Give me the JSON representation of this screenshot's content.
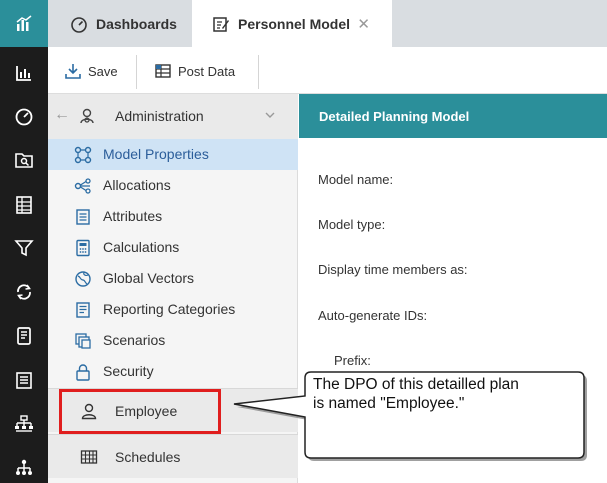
{
  "tabs": [
    {
      "label": "Dashboards",
      "icon": "dashboard-gauge-icon"
    },
    {
      "label": "Personnel Model",
      "icon": "edit-model-icon",
      "close": "✕"
    }
  ],
  "toolbar": {
    "save_label": "Save",
    "post_label": "Post Data"
  },
  "rail_icons": [
    "analytics-logo-icon",
    "bar-chart-icon",
    "gauge-icon",
    "search-folder-icon",
    "spreadsheet-icon",
    "filter-icon",
    "sync-icon",
    "calendar-book-icon",
    "report-icon",
    "hierarchy-icon",
    "org-chart-icon"
  ],
  "nav": {
    "header_label": "Administration",
    "back_glyph": "←",
    "items": [
      {
        "label": "Model Properties",
        "icon": "model-properties-icon",
        "selected": true
      },
      {
        "label": "Allocations",
        "icon": "allocations-icon"
      },
      {
        "label": "Attributes",
        "icon": "attributes-icon"
      },
      {
        "label": "Calculations",
        "icon": "calculator-icon"
      },
      {
        "label": "Global Vectors",
        "icon": "globe-icon"
      },
      {
        "label": "Reporting Categories",
        "icon": "report-categories-icon"
      },
      {
        "label": "Scenarios",
        "icon": "scenarios-icon"
      },
      {
        "label": "Security",
        "icon": "lock-icon"
      }
    ],
    "employee_label": "Employee",
    "schedules_label": "Schedules"
  },
  "main": {
    "header": "Detailed Planning Model",
    "fields": [
      "Model name:",
      "Model type:",
      "Display time members as:",
      "Auto-generate IDs:",
      "Prefix:"
    ]
  },
  "callout": {
    "line1": "The DPO of this detailled plan",
    "line2": "is named \"Employee.\""
  },
  "colors": {
    "accent": "#2b8f9a",
    "rail": "#1c1c1c",
    "selected": "#cfe3f5",
    "highlight": "#e01e1e"
  }
}
